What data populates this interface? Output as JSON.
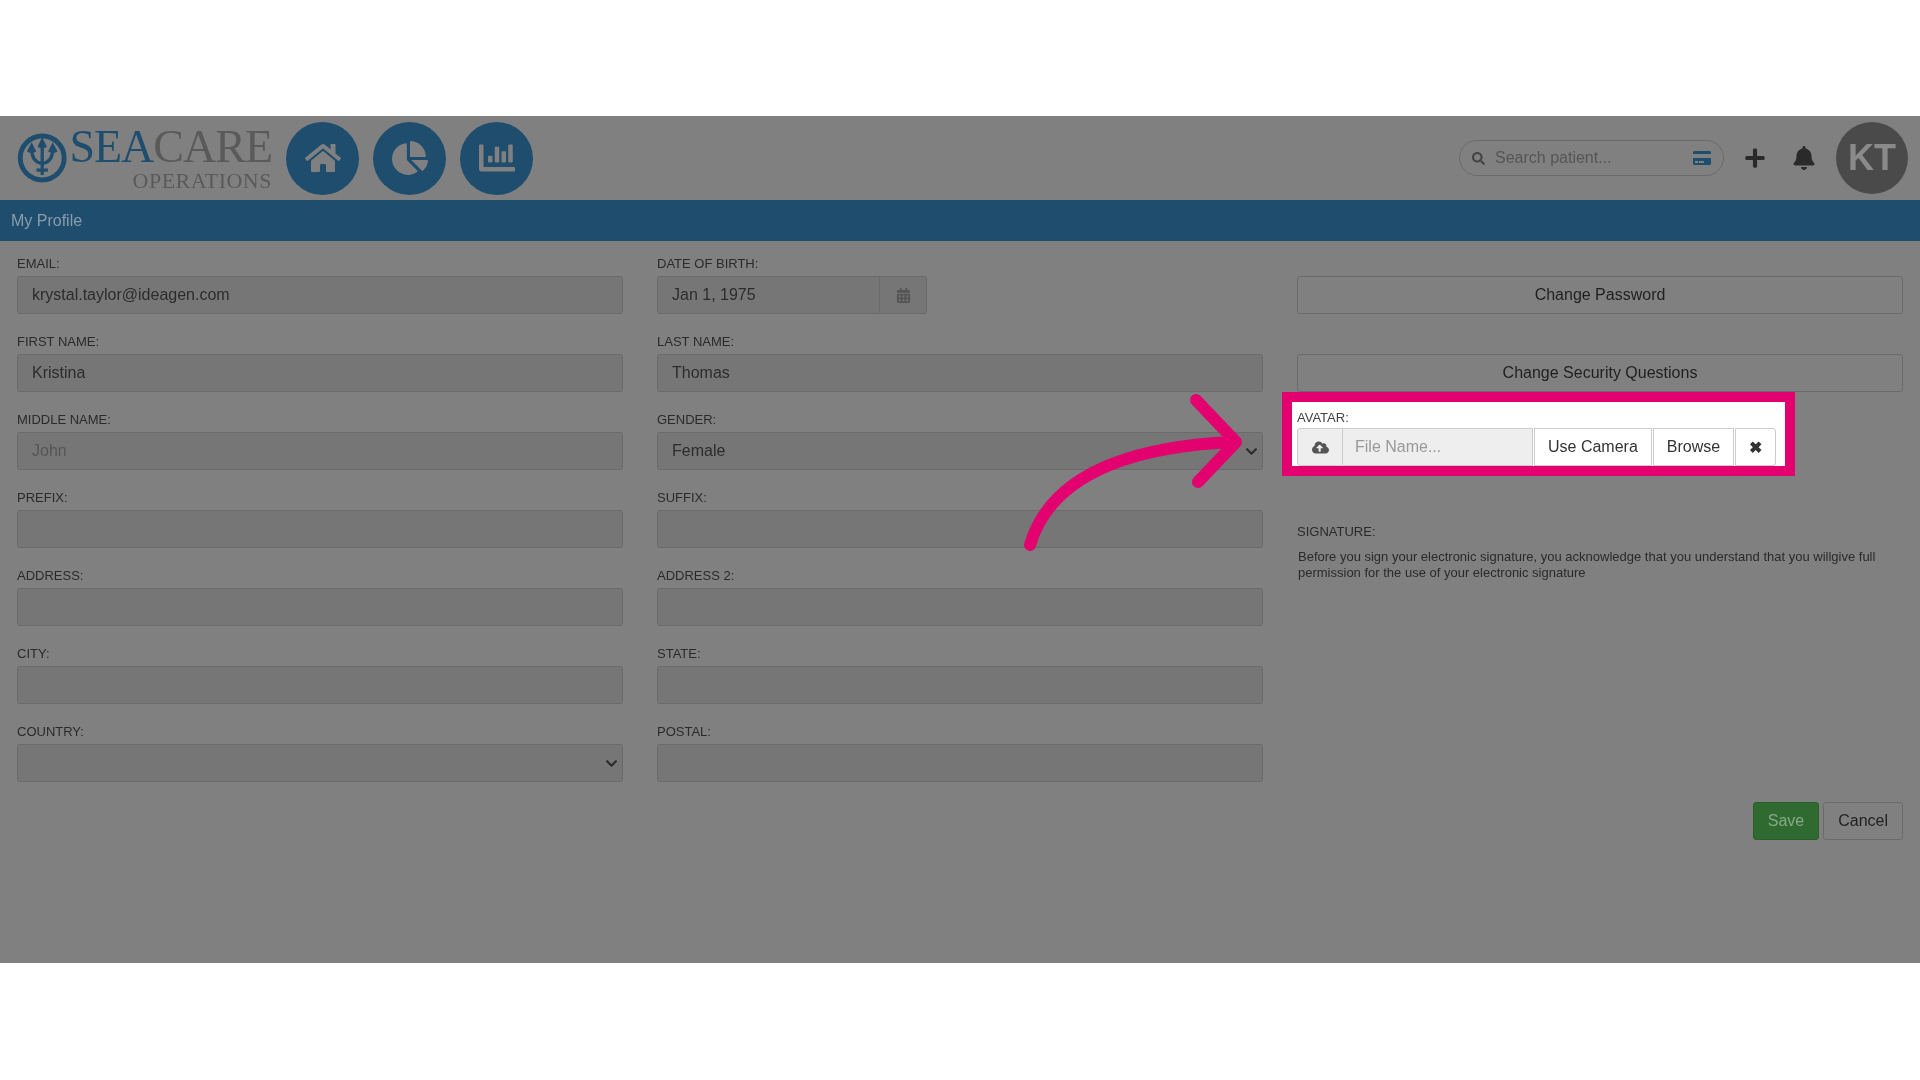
{
  "header": {
    "logo": {
      "word_1": "SEA",
      "word_2": "CARE",
      "subtitle": "OPERATIONS"
    },
    "search": {
      "placeholder": "Search patient..."
    },
    "user_initials": "KT"
  },
  "page_title": "My Profile",
  "fields": [
    {
      "label": "EMAIL:",
      "kind": "text",
      "value": "krystal.taylor@ideagen.com"
    },
    {
      "label": "DATE OF BIRTH:",
      "kind": "date",
      "value": "Jan 1, 1975"
    },
    {
      "label": "FIRST NAME:",
      "kind": "text",
      "value": "Kristina"
    },
    {
      "label": "LAST NAME:",
      "kind": "text",
      "value": "Thomas"
    },
    {
      "label": "MIDDLE NAME:",
      "kind": "text",
      "placeholder": "John"
    },
    {
      "label": "GENDER:",
      "kind": "select",
      "value": "Female"
    },
    {
      "label": "PREFIX:",
      "kind": "text"
    },
    {
      "label": "SUFFIX:",
      "kind": "text"
    },
    {
      "label": "ADDRESS:",
      "kind": "text"
    },
    {
      "label": "ADDRESS 2:",
      "kind": "text"
    },
    {
      "label": "CITY:",
      "kind": "text"
    },
    {
      "label": "STATE:",
      "kind": "text"
    },
    {
      "label": "COUNTRY:",
      "kind": "select"
    },
    {
      "label": "POSTAL:",
      "kind": "text"
    }
  ],
  "side_buttons": [
    "Change Password",
    "Change Security Questions"
  ],
  "avatar": {
    "label": "AVATAR:",
    "highlighted": true,
    "placeholder": "File Name...",
    "buttons": [
      "Use Camera",
      "Browse"
    ],
    "clear": "✖"
  },
  "signature": {
    "label": "SIGNATURE:",
    "text": "Before you sign your electronic signature, you acknowledge that you understand that you willgive full permission for the use of your electronic signature"
  },
  "actions": {
    "save": "Save",
    "cancel": "Cancel"
  }
}
